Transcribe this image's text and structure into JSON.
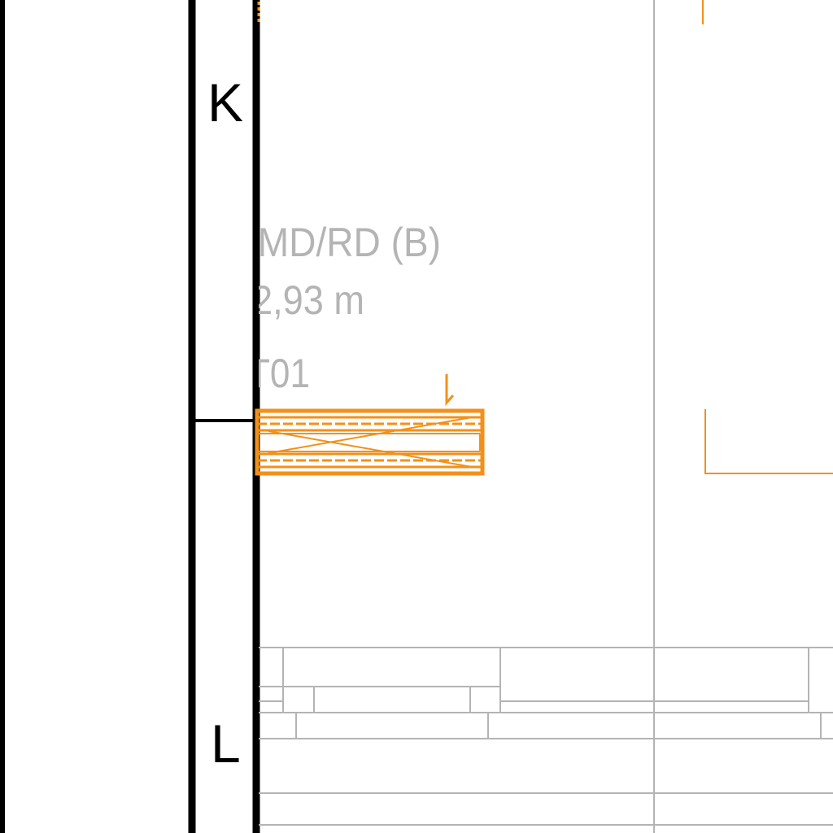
{
  "grid_labels": {
    "upper": "K",
    "lower": "L"
  },
  "annotation": {
    "line1": "/MD/RD (B)",
    "line2": "2,93 m",
    "line3": "T01"
  },
  "colors": {
    "frame": "#000000",
    "annotation_text": "#b4b4b4",
    "element": "#f39019",
    "table_lines": "#b4b4b4"
  },
  "legend": {
    "tick_icon": "elevation-marker-icon",
    "element_icon": "beam-section-hatch-icon"
  }
}
